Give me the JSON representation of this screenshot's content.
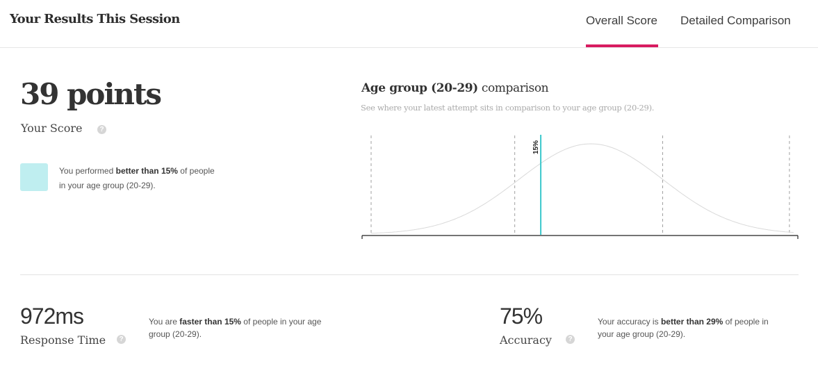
{
  "header": {
    "title": "Your Results This Session",
    "tabs": [
      {
        "label": "Overall Score",
        "active": true
      },
      {
        "label": "Detailed Comparison",
        "active": false
      }
    ],
    "accent_color": "#d81b60"
  },
  "score": {
    "value": "39 points",
    "label": "Your Score",
    "help_icon": "question-circle-icon",
    "swatch_color": "#bfeef0",
    "performance": {
      "prefix": "You performed ",
      "highlight": "better than 15%",
      "suffix": " of people in your age group (20-29)."
    }
  },
  "comparison": {
    "title_bold": "Age group (20-29)",
    "title_rest": " comparison",
    "subtitle": "See where your latest attempt sits in comparison to your age group (20-29)."
  },
  "chart_data": {
    "type": "line",
    "title": "Age group (20-29) comparison",
    "curve": "normal-distribution",
    "curve_color": "#d9d9d9",
    "marker": {
      "label": "15%",
      "percentile": 15,
      "color": "#3cc8cc"
    },
    "dashed_reference_positions": [
      0.0,
      0.34,
      0.69,
      0.99
    ],
    "xlabel": "",
    "ylabel": ""
  },
  "metrics": {
    "response_time": {
      "value": "972ms",
      "label": "Response Time",
      "desc_prefix": "You are ",
      "desc_highlight": "faster than 15%",
      "desc_suffix": " of people in your age group (20-29)."
    },
    "accuracy": {
      "value": "75%",
      "label": "Accuracy",
      "desc_prefix": "Your accuracy is ",
      "desc_highlight": "better than 29%",
      "desc_suffix": " of people in your age group (20-29)."
    }
  }
}
